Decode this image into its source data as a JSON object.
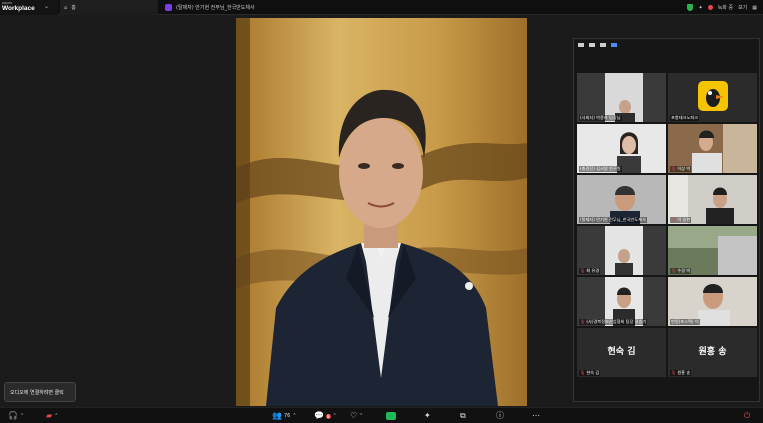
{
  "app": {
    "brand_small": "zoom",
    "brand": "Workplace"
  },
  "tabs": {
    "home": "홈",
    "meeting": "(탈제자) 안기현 전무님_한국반도체사"
  },
  "topbar": {
    "record_label": "녹화 중",
    "view_label": "보기"
  },
  "gallery": {
    "tiles": [
      {
        "label": "(사회자) 박종하 팀장님",
        "muted": false,
        "video": true
      },
      {
        "label": "포항테크노파크",
        "muted": false,
        "video": true
      },
      {
        "label": "(총경진) 김서영 연구원",
        "muted": false,
        "video": true
      },
      {
        "label": "이상 박",
        "muted": true,
        "video": true
      },
      {
        "label": "(탈제자) 안기현 전무님_한국반도체사",
        "muted": false,
        "video": true
      },
      {
        "label": "이 승현",
        "muted": true,
        "video": true
      },
      {
        "label": "최 유경",
        "muted": true,
        "video": true
      },
      {
        "label": "수경 박",
        "muted": true,
        "video": true
      },
      {
        "label": "(사)경북정보산업협회 팀장 정승기",
        "muted": true,
        "video": true
      },
      {
        "label": "변원(포스텍) 이",
        "muted": false,
        "video": true
      },
      {
        "label": "현숙 김",
        "name": "현숙 김",
        "muted": true,
        "video": false
      },
      {
        "label": "원홍 송",
        "name": "원홍 송",
        "muted": true,
        "video": false
      }
    ]
  },
  "bottombar": {
    "participants_count": "76",
    "chat_badge": "8",
    "tooltip": "오디오에 연결하려면 클릭"
  },
  "colors": {
    "accent": "#4a8cff",
    "record": "#e5484d",
    "share": "#1fb85a"
  }
}
